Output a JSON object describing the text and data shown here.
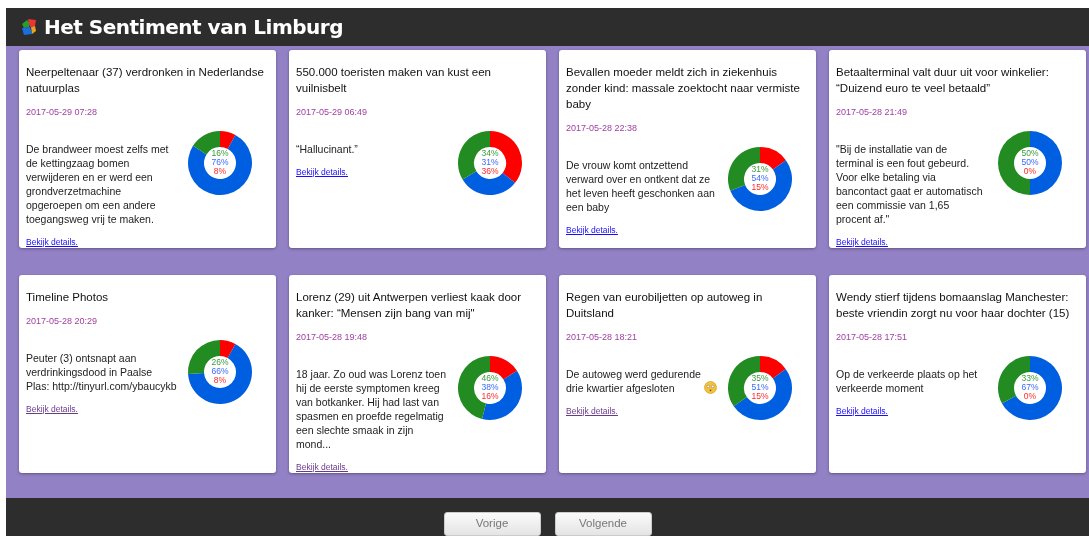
{
  "header": {
    "title": "Het Sentiment van Limburg"
  },
  "articles": [
    {
      "title": "Neerpeltenaar (37) verdronken in Nederlandse natuurplas",
      "date": "2017-05-29 07:28",
      "text": "De brandweer moest zelfs met de kettingzaag bomen verwijderen en er werd een grondverzetmachine opgeroepen om een andere toegangsweg vrij te maken.",
      "link": "Bekijk details.",
      "visited": false,
      "percentages": [
        "16%",
        "76%",
        "8%"
      ],
      "chart_data": {
        "type": "donut",
        "values": [
          16,
          76,
          8
        ]
      }
    },
    {
      "title": "550.000 toeristen maken van kust een vuilnisbelt",
      "date": "2017-05-29 06:49",
      "text": "“Hallucinant.”",
      "link": "Bekijk details.",
      "visited": false,
      "percentages": [
        "34%",
        "31%",
        "36%"
      ],
      "chart_data": {
        "type": "donut",
        "values": [
          34,
          31,
          36
        ]
      }
    },
    {
      "title": "Bevallen moeder meldt zich in ziekenhuis zonder kind: massale zoektocht naar vermiste baby",
      "date": "2017-05-28 22:38",
      "text": "De vrouw komt ontzettend verward over en ontkent dat ze het leven heeft geschonken aan een baby",
      "link": "Bekijk details.",
      "visited": false,
      "percentages": [
        "31%",
        "54%",
        "15%"
      ],
      "chart_data": {
        "type": "donut",
        "values": [
          31,
          54,
          15
        ]
      }
    },
    {
      "title": "Betaalterminal valt duur uit voor winkelier: “Duizend euro te veel betaald”",
      "date": "2017-05-28 21:49",
      "text": "\"Bij de installatie van de terminal is een fout gebeurd. Voor elke betaling via bancontact gaat er automatisch een commissie van 1,65 procent af.\"",
      "link": "Bekijk details.",
      "visited": false,
      "percentages": [
        "50%",
        "50%",
        "0%"
      ],
      "chart_data": {
        "type": "donut",
        "values": [
          50,
          50,
          0
        ]
      }
    },
    {
      "title": "Timeline Photos",
      "date": "2017-05-28 20:29",
      "text": "Peuter (3) ontsnapt aan verdrinkingsdood in Paalse Plas: http://tinyurl.com/ybaucykb",
      "link": "Bekijk details.",
      "visited": true,
      "percentages": [
        "26%",
        "66%",
        "8%"
      ],
      "chart_data": {
        "type": "donut",
        "values": [
          26,
          66,
          8
        ]
      }
    },
    {
      "title": "Lorenz (29) uit Antwerpen verliest kaak door kanker: “Mensen zijn bang van mij\"",
      "date": "2017-05-28 19:48",
      "text": "18 jaar. Zo oud was Lorenz toen hij de eerste symptomen kreeg van botkanker. Hij had last van spasmen en proefde regelmatig een slechte smaak in zijn mond...",
      "link": "Bekijk details.",
      "visited": true,
      "percentages": [
        "46%",
        "38%",
        "16%"
      ],
      "chart_data": {
        "type": "donut",
        "values": [
          46,
          38,
          16
        ]
      }
    },
    {
      "title": "Regen van eurobiljetten op autoweg in Duitsland",
      "date": "2017-05-28 18:21",
      "text": "De autoweg werd gedurende drie kwartier afgesloten",
      "emoji": true,
      "link": "Bekijk details.",
      "visited": true,
      "percentages": [
        "35%",
        "51%",
        "15%"
      ],
      "chart_data": {
        "type": "donut",
        "values": [
          35,
          51,
          15
        ]
      }
    },
    {
      "title": "Wendy stierf tijdens bomaanslag Manchester: beste vriendin zorgt nu voor haar dochter (15)",
      "date": "2017-05-28 17:51",
      "text": "Op de verkeerde plaats op het verkeerde moment",
      "link": "Bekijk details.",
      "visited": false,
      "percentages": [
        "33%",
        "67%",
        "0%"
      ],
      "chart_data": {
        "type": "donut",
        "values": [
          33,
          67,
          0
        ]
      }
    }
  ],
  "pager": {
    "buttons": [
      "Vorige",
      "Volgende"
    ]
  }
}
